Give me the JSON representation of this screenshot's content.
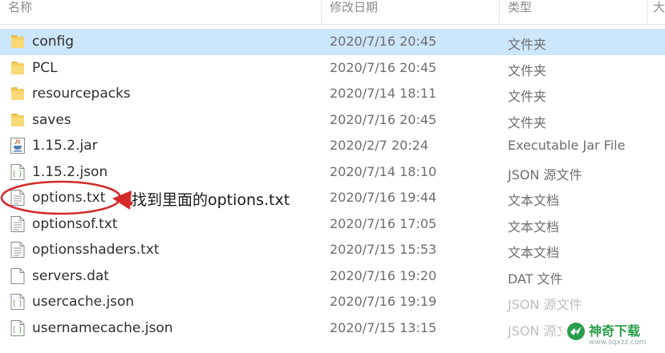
{
  "header": {
    "name_label": "名称",
    "date_label": "修改日期",
    "type_label": "类型",
    "size_label": "大"
  },
  "files": [
    {
      "name": "config",
      "date": "2020/7/16 20:45",
      "type": "文件夹",
      "icon": "folder-icon",
      "selected": true
    },
    {
      "name": "PCL",
      "date": "2020/7/16 20:45",
      "type": "文件夹",
      "icon": "folder-icon"
    },
    {
      "name": "resourcepacks",
      "date": "2020/7/14 18:11",
      "type": "文件夹",
      "icon": "folder-icon"
    },
    {
      "name": "saves",
      "date": "2020/7/16 20:45",
      "type": "文件夹",
      "icon": "folder-icon"
    },
    {
      "name": "1.15.2.jar",
      "date": "2020/2/7 20:24",
      "type": "Executable Jar File",
      "icon": "jar-file-icon"
    },
    {
      "name": "1.15.2.json",
      "date": "2020/7/14 18:10",
      "type": "JSON 源文件",
      "icon": "json-file-icon"
    },
    {
      "name": "options.txt",
      "date": "2020/7/16 19:44",
      "type": "文本文档",
      "icon": "text-file-icon"
    },
    {
      "name": "optionsof.txt",
      "date": "2020/7/16 17:05",
      "type": "文本文档",
      "icon": "text-file-icon"
    },
    {
      "name": "optionsshaders.txt",
      "date": "2020/7/15 15:53",
      "type": "文本文档",
      "icon": "text-file-icon"
    },
    {
      "name": "servers.dat",
      "date": "2020/7/16 19:20",
      "type": "DAT 文件",
      "icon": "blank-file-icon"
    },
    {
      "name": "usercache.json",
      "date": "2020/7/16 19:19",
      "type": "JSON 源文件",
      "icon": "json-file-icon",
      "faded": true
    },
    {
      "name": "usernamecache.json",
      "date": "2020/7/15 13:15",
      "type": "JSON 源文件",
      "icon": "json-file-icon",
      "faded": true
    }
  ],
  "annotation": {
    "text": "找到里面的options.txt",
    "color": "#d42a2a"
  },
  "watermark": {
    "text": "神奇下载",
    "url": "www.sqxzz.com",
    "color": "#2a9d4b"
  },
  "colors": {
    "selection": "#cce6fb",
    "folder": "#f5cd5e"
  }
}
